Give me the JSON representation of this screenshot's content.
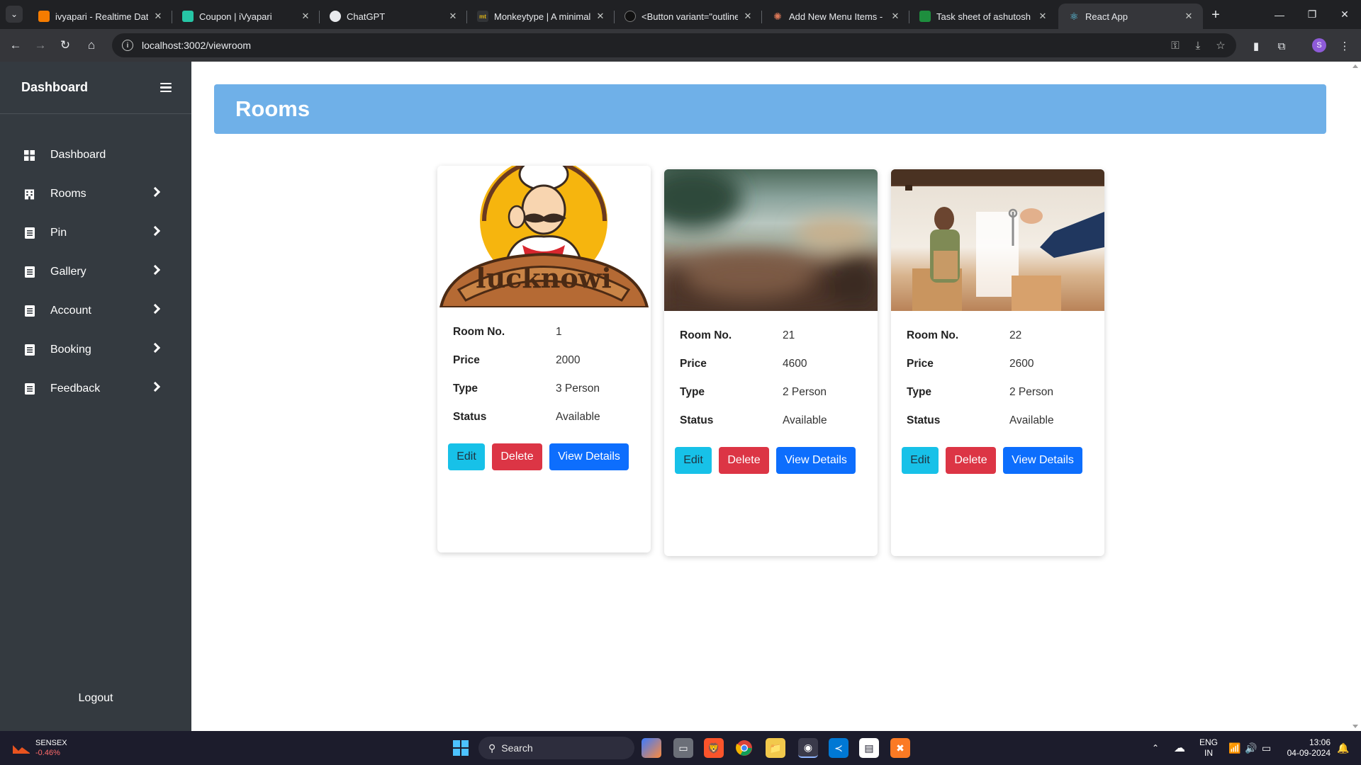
{
  "browser": {
    "tabs": [
      {
        "title": "ivyapari - Realtime Datab",
        "favicon": "#f57c00"
      },
      {
        "title": "Coupon | iVyapari",
        "favicon": "#26c6a6"
      },
      {
        "title": "ChatGPT",
        "favicon": "#e8eaed"
      },
      {
        "title": "Monkeytype | A minimalis",
        "favicon": "#e2b714"
      },
      {
        "title": "<Button variant=\"outline",
        "favicon": "#111111"
      },
      {
        "title": "Add New Menu Items - C",
        "favicon": "#d97757"
      },
      {
        "title": "Task sheet of ashutosh - G",
        "favicon": "#1e8e3e"
      },
      {
        "title": "React App",
        "favicon": "#61dafb"
      }
    ],
    "url": "localhost:3002/viewroom",
    "profile_initial": "S"
  },
  "sidebar": {
    "title": "Dashboard",
    "items": [
      {
        "label": "Dashboard",
        "icon": "grid-icon",
        "chevron": false
      },
      {
        "label": "Rooms",
        "icon": "building-icon",
        "chevron": true
      },
      {
        "label": "Pin",
        "icon": "document-icon",
        "chevron": true
      },
      {
        "label": "Gallery",
        "icon": "document-icon",
        "chevron": true
      },
      {
        "label": "Account",
        "icon": "document-icon",
        "chevron": true
      },
      {
        "label": "Booking",
        "icon": "document-icon",
        "chevron": true
      },
      {
        "label": "Feedback",
        "icon": "document-icon",
        "chevron": true
      }
    ],
    "logout_label": "Logout"
  },
  "main": {
    "title": "Rooms",
    "field_labels": {
      "room_no": "Room No.",
      "price": "Price",
      "type": "Type",
      "status": "Status"
    },
    "buttons": {
      "edit": "Edit",
      "delete": "Delete",
      "view": "View Details"
    },
    "rooms": [
      {
        "room_no": "1",
        "price": "2000",
        "type": "3 Person",
        "status": "Available",
        "image": "chef-logo-lucknowi",
        "logo_text": "lucknowi"
      },
      {
        "room_no": "21",
        "price": "4600",
        "type": "2 Person",
        "status": "Available",
        "image": "blurred-beach-photo"
      },
      {
        "room_no": "22",
        "price": "2600",
        "type": "2 Person",
        "status": "Available",
        "image": "house-keys-handover-photo"
      }
    ]
  },
  "taskbar": {
    "stock_name": "SENSEX",
    "stock_change": "-0.46%",
    "search_label": "Search",
    "language": "ENG",
    "region": "IN",
    "time": "13:06",
    "date": "04-09-2024"
  },
  "colors": {
    "sidebar_bg": "#343a40",
    "banner_bg": "#6fb0e8",
    "edit_btn": "#17c1e8",
    "delete_btn": "#dc3545",
    "view_btn": "#0d6efd"
  }
}
